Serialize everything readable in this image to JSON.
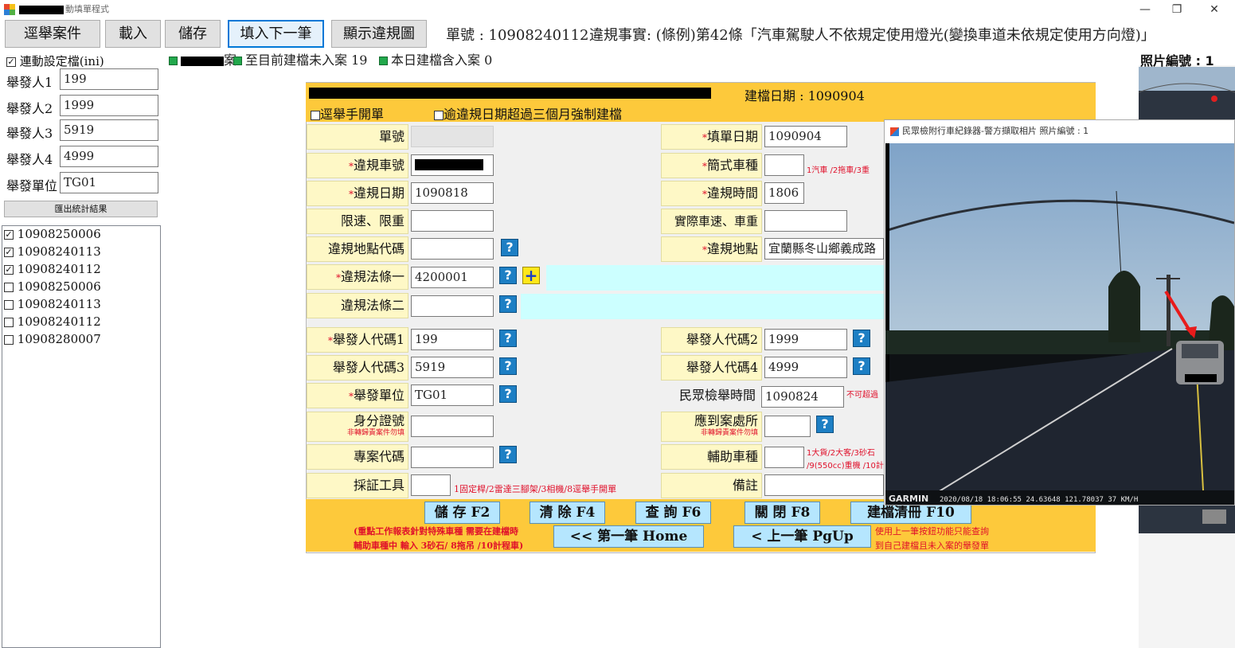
{
  "window": {
    "title_suffix": "動填單程式",
    "controls": [
      "—",
      "❐",
      "✕"
    ]
  },
  "toolbar": {
    "buttons": [
      "逕舉案件",
      "載入",
      "儲存",
      "填入下一筆",
      "顯示違規圖"
    ],
    "ticket_no": "單號 : 10908240112",
    "violation_fact": "違規事實: (條例)第42條「汽車駕駛人不依規定使用燈光(變換車道未依規定使用方向燈)」"
  },
  "left_panel": {
    "sync_ini": "連動設定檔(ini)",
    "reporters": [
      {
        "label": "舉發人1",
        "value": "199"
      },
      {
        "label": "舉發人2",
        "value": "1999"
      },
      {
        "label": "舉發人3",
        "value": "5919"
      },
      {
        "label": "舉發人4",
        "value": "4999"
      }
    ],
    "unit_label": "舉發單位",
    "unit_value": "TG01",
    "export_button": "匯出統計結果",
    "cases": [
      {
        "id": "10908250006",
        "checked": true
      },
      {
        "id": "10908240113",
        "checked": true
      },
      {
        "id": "10908240112",
        "checked": true
      },
      {
        "id": "10908250006",
        "checked": false
      },
      {
        "id": "10908240113",
        "checked": false
      },
      {
        "id": "10908240112",
        "checked": false
      },
      {
        "id": "10908280007",
        "checked": false
      }
    ]
  },
  "status": {
    "first": "案",
    "pending": "至目前建檔未入案 19",
    "today": "本日建檔含入案 0"
  },
  "photo": {
    "label": "照片編號 : 1",
    "popup_title": "民眾檢附行車紀錄器-警方擷取相片 照片編號 : 1",
    "brand": "GARMIN",
    "overlay": "2020/08/18 18:06:55  24.63648 121.78037  37 KM/H"
  },
  "form": {
    "file_date": "建檔日期 : 1090904",
    "manual_ticket": "逕舉手開單",
    "overdue": "逾違規日期超過三個月強制建檔",
    "fields": {
      "ticket_no": {
        "label": "單號",
        "value": ""
      },
      "fill_date": {
        "label": "填單日期",
        "value": "1090904"
      },
      "plate": {
        "label": "違規車號",
        "value": ""
      },
      "vehicle_type": {
        "label": "簡式車種",
        "value": "",
        "hint": "1汽車 /2拖車/3重"
      },
      "violation_date": {
        "label": "違規日期",
        "value": "1090818"
      },
      "violation_time": {
        "label": "違規時間",
        "value": "1806"
      },
      "speed_limit": {
        "label": "限速、限重",
        "value": ""
      },
      "actual_speed": {
        "label": "實際車速、車重",
        "value": ""
      },
      "location_code": {
        "label": "違規地點代碼",
        "value": ""
      },
      "location": {
        "label": "違規地點",
        "value": "宜蘭縣冬山鄉義成路"
      },
      "law1": {
        "label": "違規法條一",
        "value": "4200001"
      },
      "law2": {
        "label": "違規法條二",
        "value": ""
      },
      "reporter_code1": {
        "label": "舉發人代碼1",
        "value": "199"
      },
      "reporter_code2": {
        "label": "舉發人代碼2",
        "value": "1999"
      },
      "reporter_code3": {
        "label": "舉發人代碼3",
        "value": "5919"
      },
      "reporter_code4": {
        "label": "舉發人代碼4",
        "value": "4999"
      },
      "unit": {
        "label": "舉發單位",
        "value": "TG01"
      },
      "public_report_time": {
        "label": "民眾檢舉時間",
        "value": "1090824",
        "hint": "不可超過"
      },
      "id_no": {
        "label": "身分證號",
        "value": "",
        "hint": "非轉歸責案件勿填"
      },
      "station": {
        "label": "應到案處所",
        "value": "",
        "hint": "非轉歸責案件勿填"
      },
      "project_code": {
        "label": "專案代碼",
        "value": ""
      },
      "aux_vehicle": {
        "label": "輔助車種",
        "value": "",
        "hint1": "1大貨/2大客/3砂石",
        "hint2": "/9(550cc)重機 /10計"
      },
      "evidence_tool": {
        "label": "採証工具",
        "value": "",
        "hint": "1固定桿/2雷達三腳架/3相機/8逕舉手開單"
      },
      "remark": {
        "label": "備註",
        "value": ""
      }
    },
    "buttons": {
      "save": "儲 存 F2",
      "clear": "清 除 F4",
      "query": "查 詢 F6",
      "close": "關 閉 F8",
      "clear_file": "建檔清冊 F10",
      "first": "<< 第一筆 Home",
      "prev": "< 上一筆 PgUp"
    },
    "footer_note1": "(重點工作報表針對特殊車種 需要在建檔時",
    "footer_note2": "輔助車種中 輸入 3砂石/ 8拖吊 /10計程車)",
    "footer_note3": "使用上一筆按鈕功能只能查詢",
    "footer_note4": "到自己建檔且未入案的舉發單"
  },
  "colors": {
    "header_yellow": "#fdc93b",
    "label_bg": "#fef8c6",
    "cyan": "#ccffff",
    "required": "#e0112b",
    "button_blue": "#b5e6fe"
  }
}
